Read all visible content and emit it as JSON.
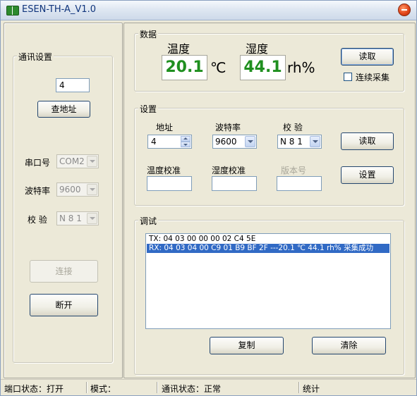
{
  "window": {
    "title": "ESEN-TH-A_V1.0"
  },
  "comm_settings": {
    "group_label": "通讯设置",
    "address_value": "4",
    "find_address_label": "查地址",
    "port_label": "串口号",
    "port_value": "COM2",
    "baud_label": "波特率",
    "baud_value": "9600",
    "parity_label": "校 验",
    "parity_value": "N 8 1",
    "connect_label": "连接",
    "disconnect_label": "断开"
  },
  "data_group": {
    "group_label": "数据",
    "temp_label": "温度",
    "temp_value": "20.1",
    "temp_unit": "℃",
    "humidity_label": "湿度",
    "humidity_value": "44.1",
    "humidity_unit": "rh%",
    "read_label": "读取",
    "continuous_label": "连续采集",
    "continuous_checked": false
  },
  "settings_group": {
    "group_label": "设置",
    "address_label": "地址",
    "address_value": "4",
    "baud_label": "波特率",
    "baud_value": "9600",
    "parity_label": "校 验",
    "parity_value": "N 8 1",
    "read_label": "读取",
    "temp_cal_label": "温度校准",
    "temp_cal_value": "",
    "hum_cal_label": "湿度校准",
    "hum_cal_value": "",
    "version_label": "版本号",
    "version_value": "",
    "set_label": "设置"
  },
  "debug_group": {
    "group_label": "调试",
    "log_lines": [
      "TX: 04 03 00 00 00 02 C4 5E",
      "RX: 04 03 04 00 C9 01 B9 BF 2F  ---20.1 ℃  44.1 rh%  采集成功"
    ],
    "copy_label": "复制",
    "clear_label": "清除"
  },
  "statusbar": {
    "port_status": "端口状态：打开",
    "mode": "模式：",
    "comm_status": "通讯状态：正常",
    "stats": "统计"
  },
  "colors": {
    "readout_green": "#1f8f1f",
    "selection_blue": "#316ac5"
  },
  "icons": [
    "app-book-icon",
    "close-icon",
    "dropdown-arrow-icon",
    "spin-up-icon",
    "spin-down-icon"
  ]
}
